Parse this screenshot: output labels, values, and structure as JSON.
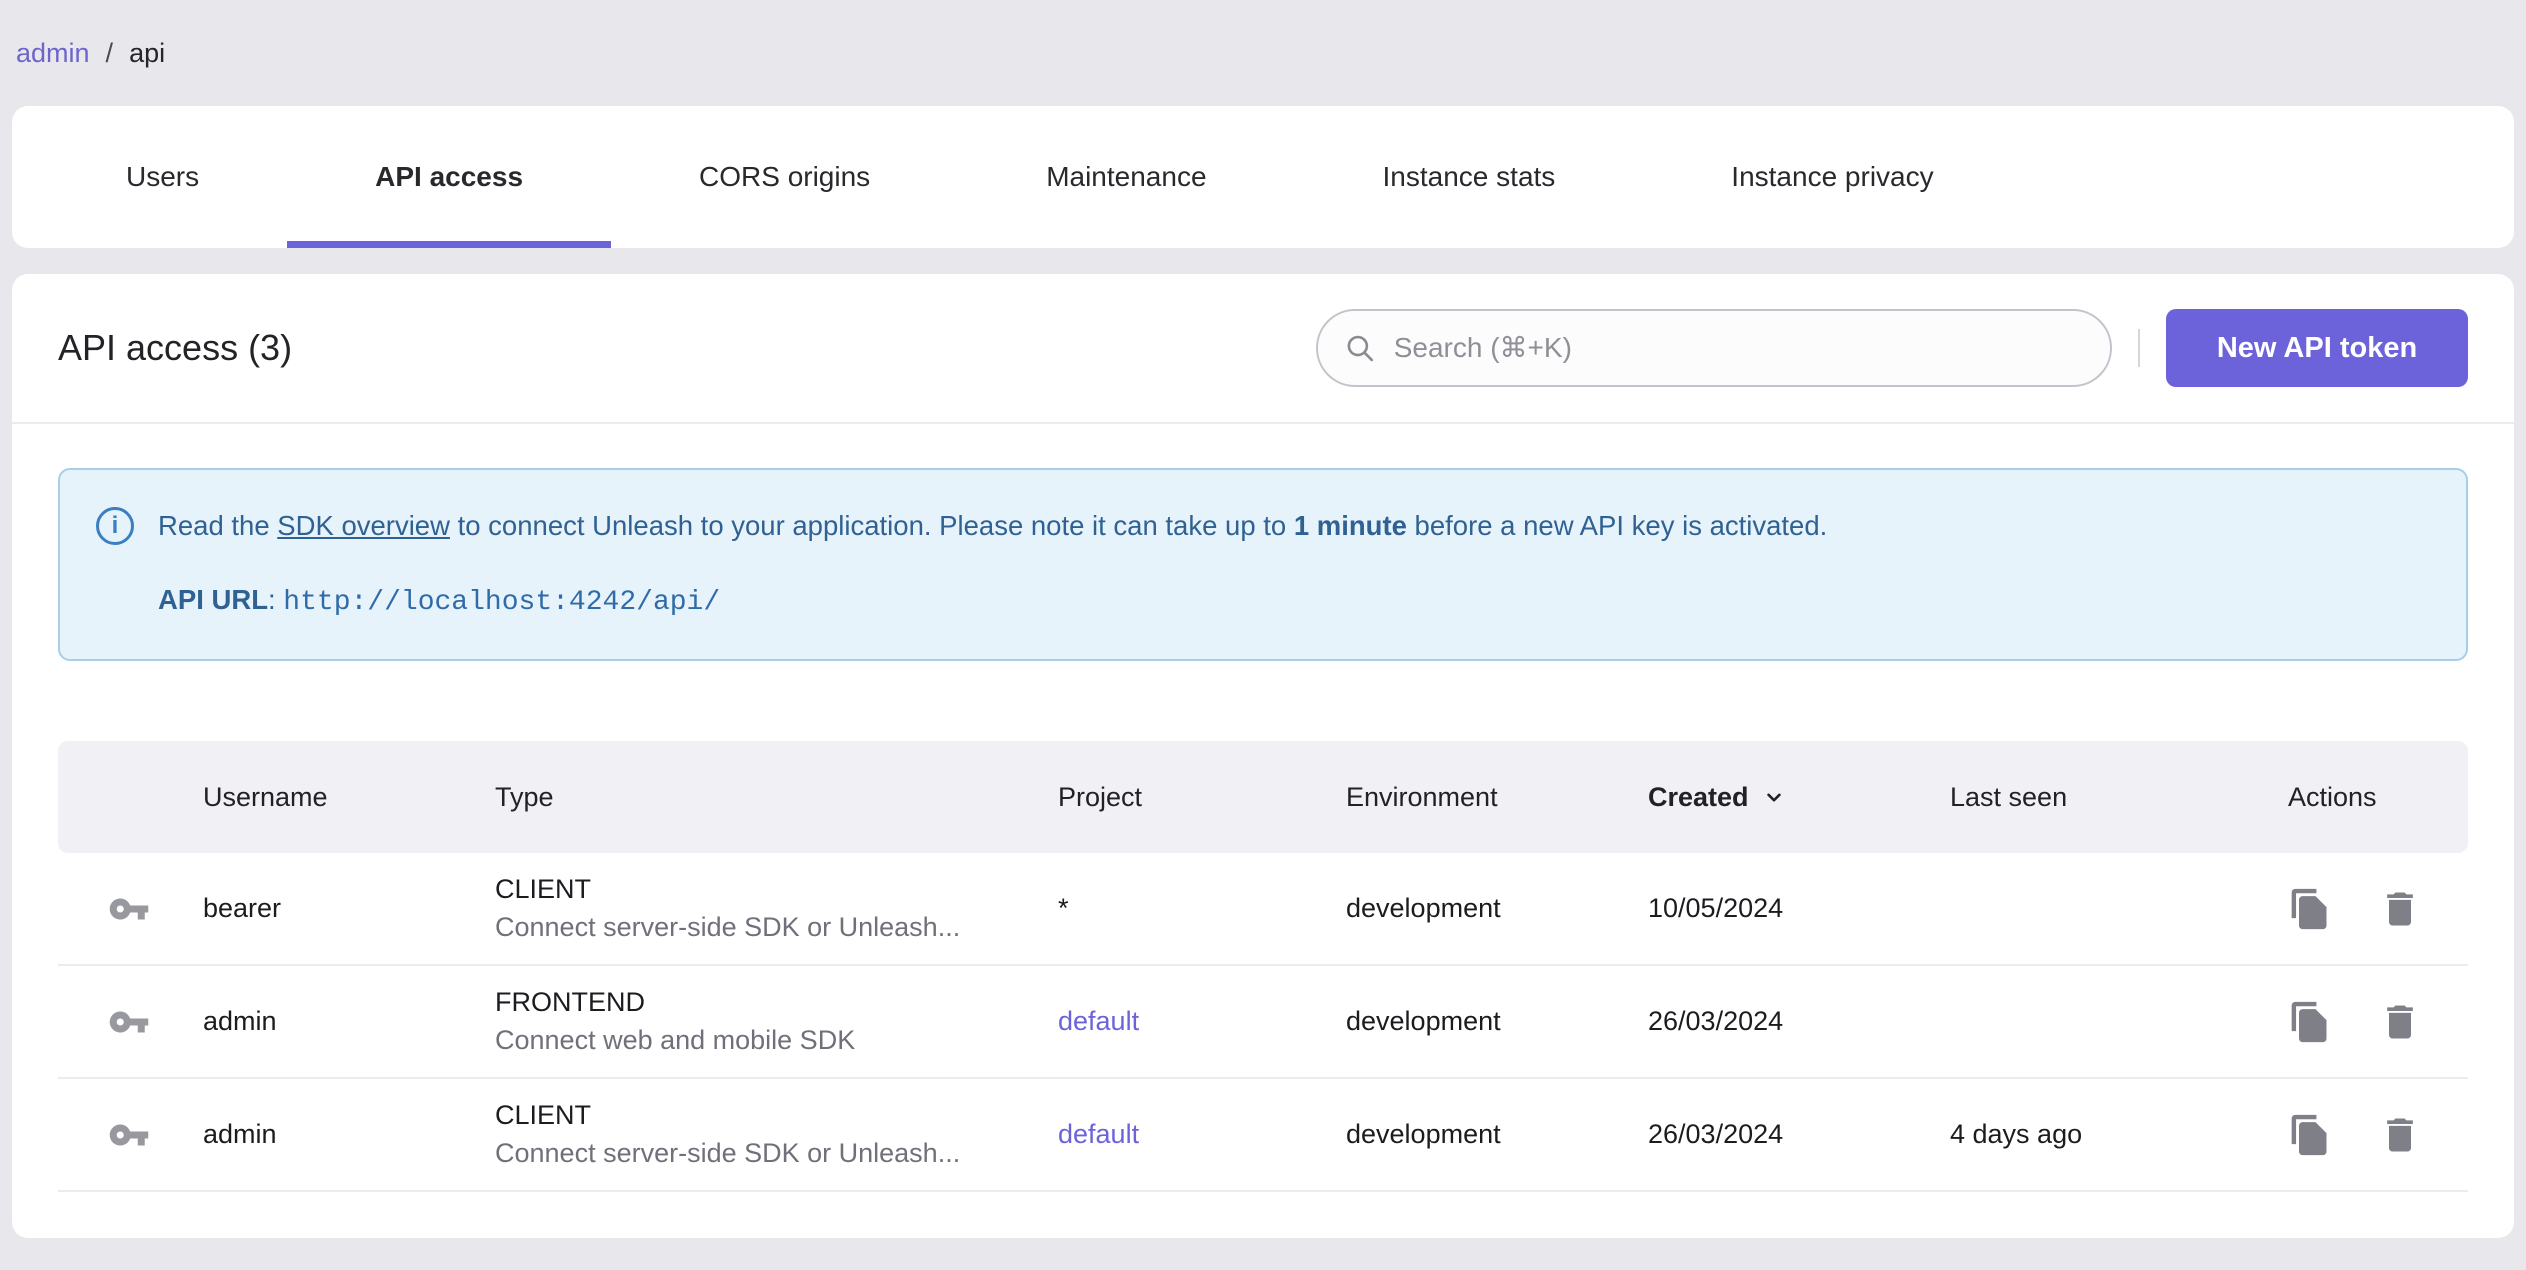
{
  "accent_color": "#6C63DB",
  "breadcrumb": {
    "link": "admin",
    "separator": "/",
    "current": "api"
  },
  "tabs": [
    {
      "label": "Users",
      "active": false
    },
    {
      "label": "API access",
      "active": true
    },
    {
      "label": "CORS origins",
      "active": false
    },
    {
      "label": "Maintenance",
      "active": false
    },
    {
      "label": "Instance stats",
      "active": false
    },
    {
      "label": "Instance privacy",
      "active": false
    }
  ],
  "header": {
    "title": "API access (3)",
    "search_placeholder": "Search (⌘+K)",
    "new_token_label": "New API token"
  },
  "info_box": {
    "read_prefix": "Read the ",
    "sdk_link": "SDK overview",
    "after_link": " to connect Unleash to your application. Please note it can take up to ",
    "bold_text": "1 minute",
    "suffix": " before a new API key is activated.",
    "api_url_label": "API URL",
    "api_url_colon": ": ",
    "api_url_value": "http://localhost:4242/api/"
  },
  "table": {
    "columns": {
      "username": "Username",
      "type": "Type",
      "project": "Project",
      "environment": "Environment",
      "created": "Created",
      "last_seen": "Last seen",
      "actions": "Actions"
    },
    "sorted_column": "Created",
    "rows": [
      {
        "username": "bearer",
        "type": "CLIENT",
        "type_desc": "Connect server-side SDK or Unleash...",
        "project": "*",
        "project_is_link": false,
        "environment": "development",
        "created": "10/05/2024",
        "last_seen": ""
      },
      {
        "username": "admin",
        "type": "FRONTEND",
        "type_desc": "Connect web and mobile SDK",
        "project": "default",
        "project_is_link": true,
        "environment": "development",
        "created": "26/03/2024",
        "last_seen": ""
      },
      {
        "username": "admin",
        "type": "CLIENT",
        "type_desc": "Connect server-side SDK or Unleash...",
        "project": "default",
        "project_is_link": true,
        "environment": "development",
        "created": "26/03/2024",
        "last_seen": "4 days ago"
      }
    ]
  }
}
